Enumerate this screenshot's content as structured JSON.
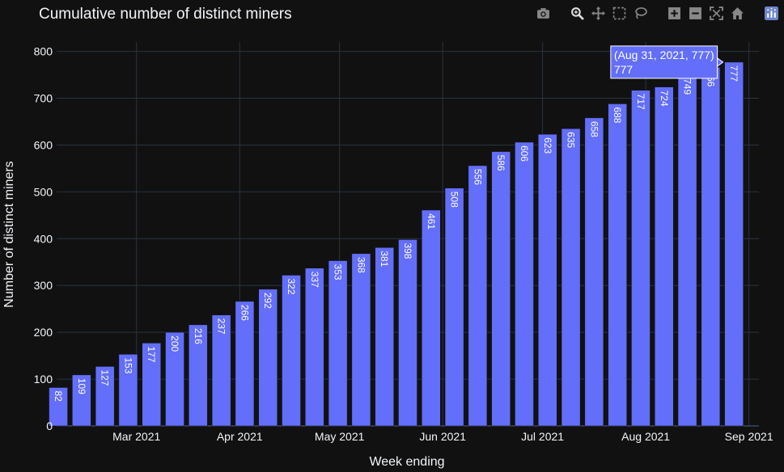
{
  "chart_data": {
    "type": "bar",
    "title": "Cumulative number of distinct miners",
    "xlabel": "Week ending",
    "ylabel": "Number of distinct miners",
    "ylim": [
      0,
      820
    ],
    "xlim": [
      "2021-02-05",
      "2021-09-04"
    ],
    "grid": true,
    "bar_color": "#636efa",
    "x": [
      "2021-02-09",
      "2021-02-16",
      "2021-02-23",
      "2021-03-02",
      "2021-03-09",
      "2021-03-16",
      "2021-03-23",
      "2021-03-30",
      "2021-04-06",
      "2021-04-13",
      "2021-04-20",
      "2021-04-27",
      "2021-05-04",
      "2021-05-11",
      "2021-05-18",
      "2021-05-25",
      "2021-06-01",
      "2021-06-08",
      "2021-06-15",
      "2021-06-22",
      "2021-06-29",
      "2021-07-06",
      "2021-07-13",
      "2021-07-20",
      "2021-07-27",
      "2021-08-03",
      "2021-08-10",
      "2021-08-17",
      "2021-08-24",
      "2021-08-31"
    ],
    "values": [
      82,
      109,
      127,
      153,
      177,
      200,
      216,
      237,
      266,
      292,
      322,
      337,
      353,
      368,
      381,
      398,
      461,
      508,
      556,
      586,
      606,
      623,
      635,
      658,
      688,
      717,
      724,
      749,
      766,
      777
    ],
    "data_labels": [
      "82",
      "109",
      "127",
      "153",
      "177",
      "200",
      "216",
      "237",
      "266",
      "292",
      "322",
      "337",
      "353",
      "368",
      "381",
      "398",
      "461",
      "508",
      "556",
      "586",
      "606",
      "623",
      "635",
      "658",
      "688",
      "717",
      "724",
      "749",
      "766",
      "777"
    ],
    "y_ticks": [
      0,
      100,
      200,
      300,
      400,
      500,
      600,
      700,
      800
    ],
    "y_tick_labels": [
      "0",
      "100",
      "200",
      "300",
      "400",
      "500",
      "600",
      "700",
      "800"
    ],
    "x_ticks": [
      "2021-03-01",
      "2021-04-01",
      "2021-05-01",
      "2021-06-01",
      "2021-07-01",
      "2021-08-01",
      "2021-09-01"
    ],
    "x_tick_labels": [
      "Mar 2021",
      "Apr 2021",
      "May 2021",
      "Jun 2021",
      "Jul 2021",
      "Aug 2021",
      "Sep 2021"
    ],
    "hover": {
      "index": 29,
      "line1": "(Aug 31, 2021, 777)",
      "line2": "777"
    }
  },
  "modebar": {
    "buttons": [
      "camera-icon",
      "zoom-icon",
      "pan-icon",
      "box-select-icon",
      "lasso-select-icon",
      "zoom-in-icon",
      "zoom-out-icon",
      "autoscale-icon",
      "reset-axes-icon",
      "plotly-logo-icon"
    ]
  }
}
